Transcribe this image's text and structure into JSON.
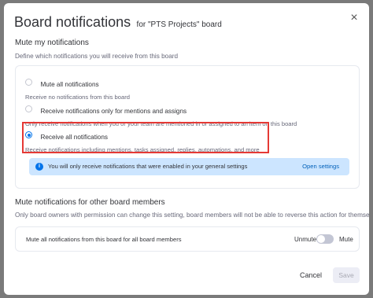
{
  "dialog": {
    "title": "Board notifications",
    "subtitle": "for \"PTS Projects\" board",
    "close_icon": "close-icon"
  },
  "mute_section": {
    "title": "Mute my notifications",
    "description": "Define which notifications you will receive from this board",
    "options": [
      {
        "label": "Mute all notifications",
        "description": "Receive no notifications from this board",
        "selected": false
      },
      {
        "label": "Receive notifications only for mentions and assigns",
        "description": "Only receive notifications when you or your team are mentioned in or assigned to an item on this board",
        "selected": false
      },
      {
        "label": "Receive all notifications",
        "description": "Receive notifications including mentions, tasks assigned, replies, automations, and more",
        "selected": true
      }
    ],
    "info": {
      "text": "You will only receive notifications that were enabled in your general settings",
      "link": "Open settings"
    }
  },
  "members_section": {
    "title": "Mute notifications for other board members",
    "description": "Only board owners with permission can change this setting, board members will not be able to reverse this action for themselves",
    "row_label": "Mute all notifications from this board for all board members",
    "unmute_label": "Unmute",
    "mute_label": "Mute",
    "toggle_on": false
  },
  "footer": {
    "cancel_label": "Cancel",
    "save_label": "Save"
  },
  "colors": {
    "accent": "#0073ea",
    "highlight": "#e53935",
    "info_bg": "#cce5ff"
  }
}
